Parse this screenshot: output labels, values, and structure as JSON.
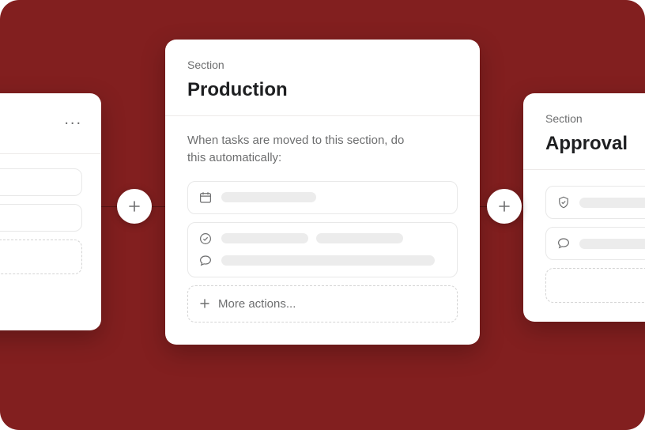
{
  "labels": {
    "section": "Section",
    "more_actions": "More actions..."
  },
  "center": {
    "title": "Production",
    "prompt": "When tasks are moved to this section, do this automatically:"
  },
  "right": {
    "title": "Approval"
  }
}
